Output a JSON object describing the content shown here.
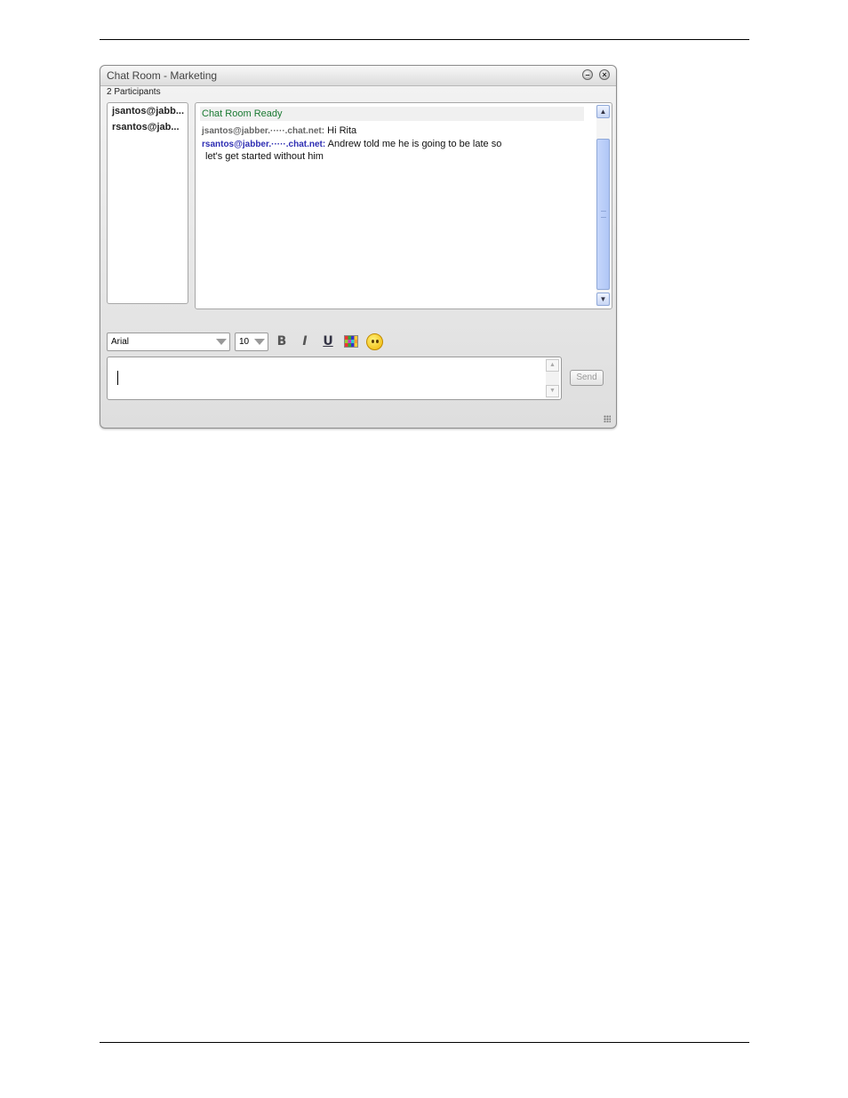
{
  "window": {
    "title": "Chat Room - Marketing",
    "minimize_icon": "minimize-icon",
    "close_icon": "close-icon"
  },
  "participants": {
    "count_label": "2 Participants",
    "items": [
      "jsantos@jabb...",
      "rsantos@jab..."
    ]
  },
  "transcript": {
    "status": "Chat Room Ready",
    "messages": [
      {
        "sender": "jsantos@jabber.·····.chat.net:",
        "text": " Hi Rita"
      },
      {
        "sender": "rsantos@jabber.·····.chat.net:",
        "text": " Andrew told me he is going to be late so"
      }
    ],
    "continuation": "let's get started without him"
  },
  "toolbar": {
    "font": "Arial",
    "size": "10",
    "bold_label": "B",
    "italic_label": "I",
    "underline_label": "U",
    "color_icon": "text-color-icon",
    "emoticon_icon": "emoticon-icon"
  },
  "input": {
    "value": ""
  },
  "send_label": "Send",
  "colors": {
    "status_green": "#1a7a32",
    "sender_blue": "#2d2db3",
    "scrollbar_blue": "#b0c6f6"
  }
}
